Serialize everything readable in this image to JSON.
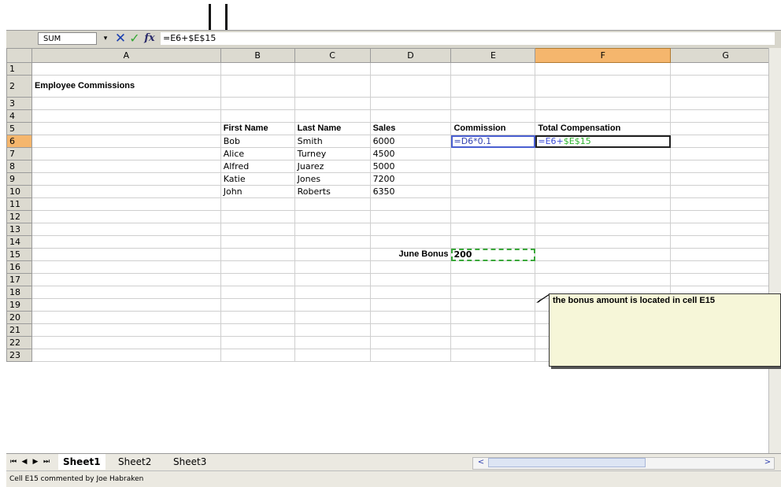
{
  "formula_bar": {
    "name_box": "SUM",
    "name_box_dropdown": "▾",
    "cancel_icon": "✕",
    "enter_icon": "✓",
    "fx_icon": "fx",
    "formula": "=E6+$E$15"
  },
  "columns": [
    "A",
    "B",
    "C",
    "D",
    "E",
    "F",
    "G"
  ],
  "active_column": "F",
  "active_row": "6",
  "rows": [
    "1",
    "2",
    "3",
    "4",
    "5",
    "6",
    "7",
    "8",
    "9",
    "10",
    "11",
    "12",
    "13",
    "14",
    "15",
    "16",
    "17",
    "18",
    "19",
    "20",
    "21",
    "22",
    "23"
  ],
  "cells": {
    "A2": "Employee Commissions",
    "B5": "First Name",
    "C5": "Last Name",
    "D5": "Sales",
    "E5": "Commission",
    "F5": "Total Compensation",
    "B6": "Bob",
    "C6": "Smith",
    "D6": "6000",
    "E6": "=D6*0.1",
    "F6_blue": "=E6+",
    "F6_green": "$E$15",
    "B7": "Alice",
    "C7": "Turney",
    "D7": "4500",
    "B8": "Alfred",
    "C8": "Juarez",
    "D8": "5000",
    "B9": "Katie",
    "C9": "Jones",
    "D9": "7200",
    "B10": "John",
    "C10": "Roberts",
    "D10": "6350",
    "D15": "June Bonus",
    "E15": "200"
  },
  "comment": {
    "text": "the bonus amount is located in cell E15"
  },
  "sheet_tabs": {
    "nav": [
      "⏮",
      "◀",
      "▶",
      "⏭"
    ],
    "tabs": [
      "Sheet1",
      "Sheet2",
      "Sheet3"
    ],
    "active": "Sheet1"
  },
  "scroll": {
    "left_arrow": "<",
    "right_arrow": ">"
  },
  "status": {
    "text": "Cell E15 commented by Joe Habraken"
  },
  "colors": {
    "active_header": "#f5b66d",
    "ref_blue": "#3c4cd8",
    "ref_green": "#2fb52f",
    "comment_bg": "#f6f6d8"
  }
}
